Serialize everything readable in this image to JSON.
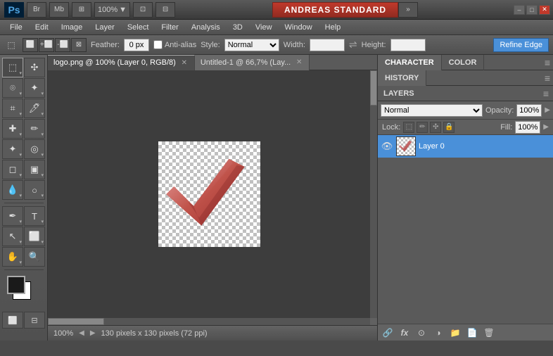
{
  "topbar": {
    "ps_label": "Ps",
    "zoom_value": "100%",
    "title": "ANDREAS STANDARD",
    "extend_label": "»",
    "minimize": "–",
    "maximize": "□",
    "close": "✕"
  },
  "menubar": {
    "items": [
      "File",
      "Edit",
      "Image",
      "Layer",
      "Select",
      "Filter",
      "Analysis",
      "3D",
      "View",
      "Window",
      "Help"
    ]
  },
  "options_bar": {
    "feather_label": "Feather:",
    "feather_value": "0 px",
    "anti_alias_label": "Anti-alias",
    "style_label": "Style:",
    "style_value": "Normal",
    "width_label": "Width:",
    "height_label": "Height:",
    "refine_edge": "Refine Edge"
  },
  "tabs": [
    {
      "label": "logo.png @ 100% (Layer 0, RGB/8)",
      "active": true
    },
    {
      "label": "Untitled-1 @ 66,7% (Lay...",
      "active": false
    }
  ],
  "status_bar": {
    "zoom": "100%",
    "info": "130 pixels x 130 pixels (72 ppi)"
  },
  "right_panel": {
    "tabs": [
      "CHARACTER",
      "COLOR"
    ],
    "active_tab": "CHARACTER",
    "history_tab": "HISTORY",
    "layers_tab": "LAYERS"
  },
  "layers": {
    "blend_mode": "Normal",
    "opacity_label": "Opacity:",
    "opacity_value": "100%",
    "lock_label": "Lock:",
    "fill_label": "Fill:",
    "fill_value": "100%",
    "items": [
      {
        "name": "Layer 0",
        "visible": true,
        "selected": true
      }
    ],
    "footer_icons": [
      "link",
      "fx",
      "circle",
      "target",
      "folder",
      "trash"
    ]
  }
}
